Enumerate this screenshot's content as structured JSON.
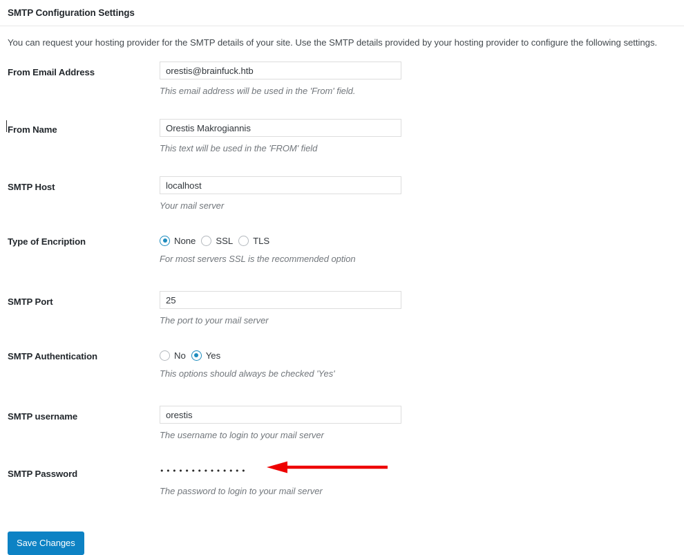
{
  "panel": {
    "title": "SMTP Configuration Settings",
    "intro": "You can request your hosting provider for the SMTP details of your site. Use the SMTP details provided by your hosting provider to configure the following settings."
  },
  "fields": {
    "from_email": {
      "label": "From Email Address",
      "value": "orestis@brainfuck.htb",
      "placeholder": "",
      "hint": "This email address will be used in the 'From' field."
    },
    "from_name": {
      "label": "From Name",
      "value": "Orestis Makrogiannis",
      "placeholder": "",
      "hint": "This text will be used in the 'FROM' field"
    },
    "smtp_host": {
      "label": "SMTP Host",
      "value": "localhost",
      "placeholder": "",
      "hint": "Your mail server"
    },
    "encryption": {
      "label": "Type of Encription",
      "hint": "For most servers SSL is the recommended option",
      "selected": "None",
      "options": [
        {
          "label": "None",
          "checked": true
        },
        {
          "label": "SSL",
          "checked": false
        },
        {
          "label": "TLS",
          "checked": false
        }
      ]
    },
    "smtp_port": {
      "label": "SMTP Port",
      "value": "25",
      "placeholder": "",
      "hint": "The port to your mail server"
    },
    "smtp_auth": {
      "label": "SMTP Authentication",
      "hint": "This options should always be checked 'Yes'",
      "selected": "Yes",
      "options": [
        {
          "label": "No",
          "checked": false
        },
        {
          "label": "Yes",
          "checked": true
        }
      ]
    },
    "smtp_username": {
      "label": "SMTP username",
      "value": "orestis",
      "placeholder": "",
      "hint": "The username to login to your mail server"
    },
    "smtp_password": {
      "label": "SMTP Password",
      "masked_value": "••••••••••••••",
      "placeholder": "",
      "hint": "The password to login to your mail server"
    }
  },
  "annotation": {
    "name": "red-arrow",
    "color": "#ee0000",
    "direction": "left"
  },
  "submit": {
    "label": "Save Changes",
    "color": "#0d82c4"
  }
}
